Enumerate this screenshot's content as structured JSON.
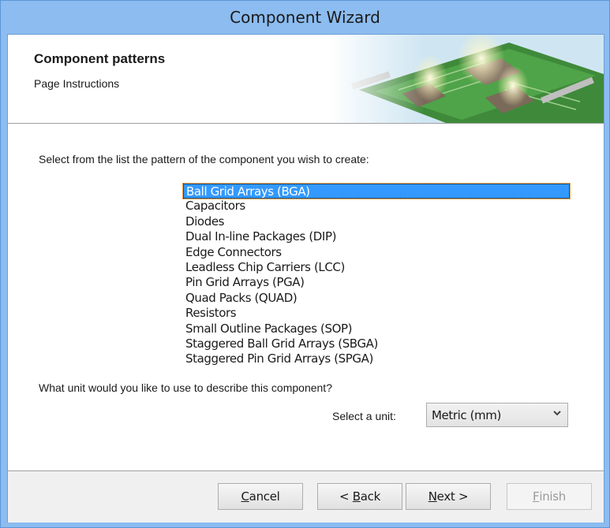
{
  "window": {
    "title": "Component Wizard"
  },
  "header": {
    "title": "Component patterns",
    "subtitle": "Page Instructions"
  },
  "main": {
    "prompt": "Select from the list the pattern of the component you wish to create:",
    "patterns": [
      "Ball Grid Arrays (BGA)",
      "Capacitors",
      "Diodes",
      "Dual In-line Packages (DIP)",
      "Edge Connectors",
      "Leadless Chip Carriers (LCC)",
      "Pin Grid Arrays (PGA)",
      "Quad Packs (QUAD)",
      "Resistors",
      "Small Outline Packages (SOP)",
      "Staggered Ball Grid Arrays (SBGA)",
      "Staggered Pin Grid Arrays (SPGA)"
    ],
    "selected_pattern": "Ball Grid Arrays (BGA)",
    "unit_question": "What unit would you like to use to describe this component?",
    "unit_label": "Select a unit:",
    "unit_value": "Metric (mm)"
  },
  "footer": {
    "cancel": {
      "mnemonic": "C",
      "rest": "ancel"
    },
    "back": {
      "prefix": "< ",
      "mnemonic": "B",
      "rest": "ack"
    },
    "next": {
      "mnemonic": "N",
      "rest": "ext >"
    },
    "finish": {
      "mnemonic": "F",
      "rest": "inish"
    }
  },
  "icons": {
    "dropdown": "chevron-down-icon"
  },
  "colors": {
    "selection": "#3399ff",
    "titlebar": "#8cbcf0"
  }
}
